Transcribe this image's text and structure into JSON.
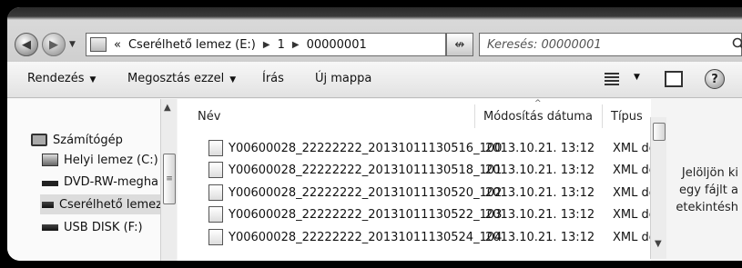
{
  "nav": {
    "back_glyph": "◀",
    "forward_glyph": "▶",
    "history_glyph": "▼",
    "address": {
      "overflow": "«",
      "segments": [
        "Cserélhető lemez (E:)",
        "1",
        "00000001"
      ],
      "separator": "▶"
    },
    "refresh_glyph": "↮",
    "search_placeholder": "Keresés: 00000001"
  },
  "toolbar": {
    "organize": "Rendezés",
    "share": "Megosztás ezzel",
    "burn": "Írás",
    "new_folder": "Új mappa",
    "caret": "▼",
    "help": "?"
  },
  "sidebar": {
    "items": [
      {
        "label": "Számítógép",
        "icon": "computer-icon"
      },
      {
        "label": "Helyi lemez (C:)",
        "icon": "hard-disk-icon"
      },
      {
        "label": "DVD-RW-megha",
        "icon": "dvd-drive-icon"
      },
      {
        "label": "Cserélhető lemez",
        "icon": "removable-disk-icon"
      },
      {
        "label": "USB DISK (F:)",
        "icon": "usb-disk-icon"
      }
    ],
    "scroll_up_glyph": "▲",
    "scroll_grip": "≡"
  },
  "filelist": {
    "columns": {
      "name": "Név",
      "date": "Módosítás dátuma",
      "type": "Típus"
    },
    "sort_glyph": "^",
    "rows": [
      {
        "name": "Y00600028_22222222_20131011130516_100",
        "date": "2013.10.21. 13:12",
        "type": "XML do"
      },
      {
        "name": "Y00600028_22222222_20131011130518_101",
        "date": "2013.10.21. 13:12",
        "type": "XML do"
      },
      {
        "name": "Y00600028_22222222_20131011130520_102",
        "date": "2013.10.21. 13:12",
        "type": "XML do"
      },
      {
        "name": "Y00600028_22222222_20131011130522_103",
        "date": "2013.10.21. 13:12",
        "type": "XML do"
      },
      {
        "name": "Y00600028_22222222_20131011130524_104",
        "date": "2013.10.21. 13:12",
        "type": "XML do"
      }
    ],
    "scroll_down_glyph": "▼"
  },
  "preview": {
    "lines": [
      "Jelöljön ki",
      "egy fájlt a",
      "etekintésh"
    ]
  }
}
